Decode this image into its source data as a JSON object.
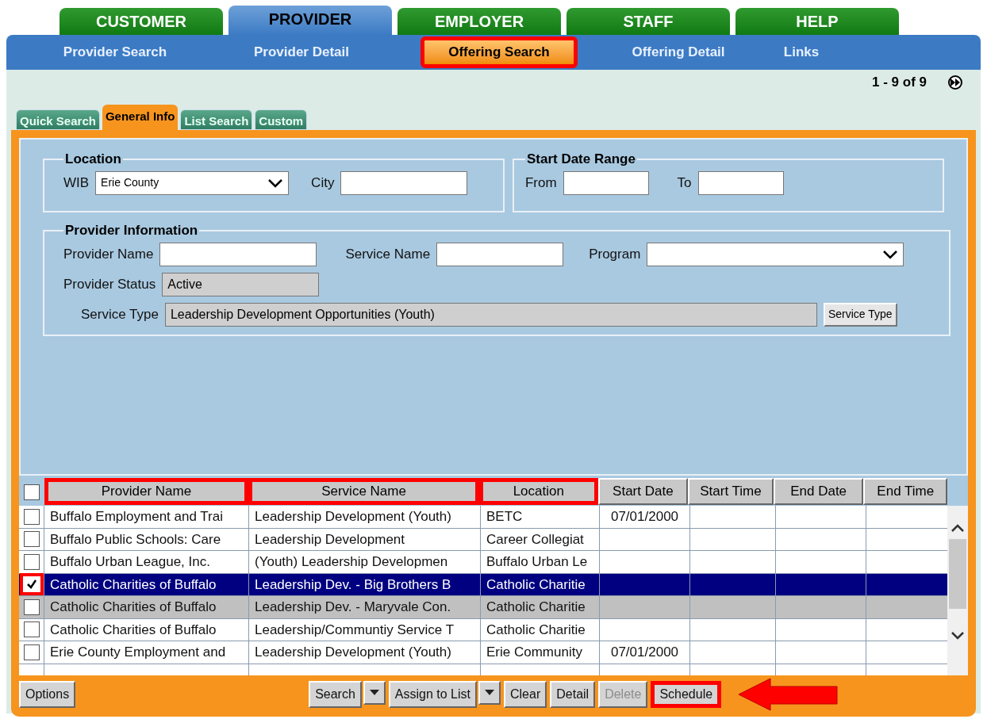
{
  "top_tabs": [
    {
      "label": "CUSTOMER",
      "selected": false
    },
    {
      "label": "PROVIDER",
      "selected": true
    },
    {
      "label": "EMPLOYER",
      "selected": false
    },
    {
      "label": "STAFF",
      "selected": false
    },
    {
      "label": "HELP",
      "selected": false
    }
  ],
  "nav": [
    {
      "label": "Provider Search",
      "selected": false,
      "annotated": false
    },
    {
      "label": "Provider Detail",
      "selected": false,
      "annotated": false
    },
    {
      "label": "Offering Search",
      "selected": true,
      "annotated": true
    },
    {
      "label": "Offering Detail",
      "selected": false,
      "annotated": false
    },
    {
      "label": "Links",
      "selected": false,
      "annotated": false
    }
  ],
  "pager": "1 - 9 of 9",
  "sub_tabs": [
    {
      "label": "Quick Search",
      "selected": false
    },
    {
      "label": "General Info",
      "selected": true
    },
    {
      "label": "List Search",
      "selected": false
    },
    {
      "label": "Custom",
      "selected": false
    }
  ],
  "location": {
    "legend": "Location",
    "wib_label": "WIB",
    "wib_value": "Erie County",
    "city_label": "City"
  },
  "date_range": {
    "legend": "Start Date Range",
    "from_label": "From",
    "to_label": "To"
  },
  "provider_info": {
    "legend": "Provider Information",
    "provider_name_label": "Provider Name",
    "service_name_label": "Service Name",
    "program_label": "Program",
    "provider_status_label": "Provider Status",
    "provider_status_value": "Active",
    "service_type_label": "Service Type",
    "service_type_value": "Leadership Development Opportunities (Youth)",
    "service_type_button": "Service Type"
  },
  "table": {
    "select_all_checked": false,
    "columns": [
      {
        "label": "Provider Name",
        "annotated": true
      },
      {
        "label": "Service Name",
        "annotated": true
      },
      {
        "label": "Location",
        "annotated": true
      },
      {
        "label": "Start Date",
        "annotated": false
      },
      {
        "label": "Start Time",
        "annotated": false
      },
      {
        "label": "End Date",
        "annotated": false
      },
      {
        "label": "End Time",
        "annotated": false
      }
    ],
    "rows": [
      {
        "checked": false,
        "selected": false,
        "hovered": false,
        "annotated": false,
        "cells": [
          "Buffalo Employment and Trai",
          "Leadership Development (Youth)",
          "BETC",
          "07/01/2000",
          "",
          "",
          ""
        ]
      },
      {
        "checked": false,
        "selected": false,
        "hovered": false,
        "annotated": false,
        "cells": [
          "Buffalo Public Schools: Care",
          "Leadership Development",
          "Career Collegiat",
          "",
          "",
          "",
          ""
        ]
      },
      {
        "checked": false,
        "selected": false,
        "hovered": false,
        "annotated": false,
        "cells": [
          "Buffalo Urban League, Inc.",
          "(Youth) Leadership Developmen",
          "Buffalo Urban Le",
          "",
          "",
          "",
          ""
        ]
      },
      {
        "checked": true,
        "selected": true,
        "hovered": false,
        "annotated": true,
        "cells": [
          "Catholic Charities of Buffalo",
          "Leadership Dev. - Big Brothers B",
          "Catholic Charitie",
          "",
          "",
          "",
          ""
        ]
      },
      {
        "checked": false,
        "selected": false,
        "hovered": true,
        "annotated": false,
        "cells": [
          "Catholic Charities of Buffalo",
          "Leadership Dev. - Maryvale Con.",
          "Catholic Charitie",
          "",
          "",
          "",
          ""
        ]
      },
      {
        "checked": false,
        "selected": false,
        "hovered": false,
        "annotated": false,
        "cells": [
          "Catholic Charities of Buffalo",
          "Leadership/Communtiy Service T",
          "Catholic Charitie",
          "",
          "",
          "",
          ""
        ]
      },
      {
        "checked": false,
        "selected": false,
        "hovered": false,
        "annotated": false,
        "cells": [
          "Erie County Employment and",
          "Leadership Development (Youth)",
          "Erie Community",
          "07/01/2000",
          "",
          "",
          ""
        ]
      }
    ]
  },
  "buttons": [
    {
      "label": "Options",
      "kind": "button",
      "disabled": false,
      "annotated": false
    },
    {
      "label": "Search",
      "kind": "split",
      "disabled": false,
      "annotated": false
    },
    {
      "label": "Assign to List",
      "kind": "split",
      "disabled": false,
      "annotated": false
    },
    {
      "label": "Clear",
      "kind": "button",
      "disabled": false,
      "annotated": false
    },
    {
      "label": "Detail",
      "kind": "button",
      "disabled": false,
      "annotated": false
    },
    {
      "label": "Delete",
      "kind": "button",
      "disabled": true,
      "annotated": false
    },
    {
      "label": "Schedule",
      "kind": "button",
      "disabled": false,
      "annotated": true
    }
  ]
}
